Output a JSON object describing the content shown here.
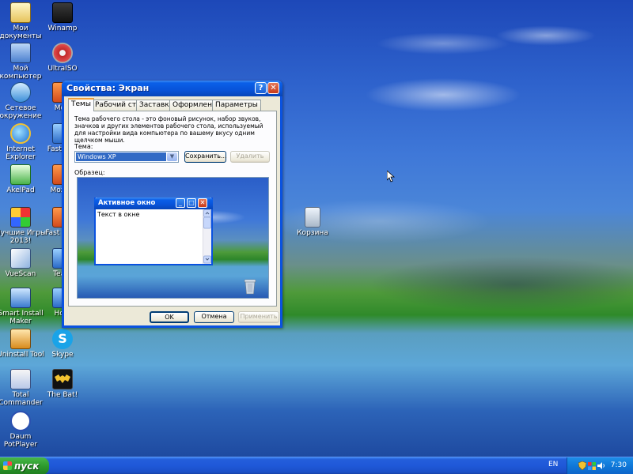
{
  "desktop": {
    "icons_col1": [
      {
        "name": "my-documents",
        "label": "Мои документы",
        "icon": "folder-docs"
      },
      {
        "name": "my-computer",
        "label": "Мой компьютер",
        "icon": "computer"
      },
      {
        "name": "network",
        "label": "Сетевое окружение",
        "icon": "network"
      },
      {
        "name": "internet-explorer",
        "label": "Internet Explorer",
        "icon": "ie"
      },
      {
        "name": "akelpad",
        "label": "AkelPad",
        "icon": "notepad"
      },
      {
        "name": "best-games",
        "label": "Лучшие Игры 2013!",
        "icon": "games"
      },
      {
        "name": "vuescan",
        "label": "VueScan",
        "icon": "scanner"
      },
      {
        "name": "smart-install-maker",
        "label": "Smart Install Maker",
        "icon": "installer"
      },
      {
        "name": "uninstall-tool",
        "label": "Uninstall Tool",
        "icon": "uninstaller"
      },
      {
        "name": "total-commander",
        "label": "Total Commander",
        "icon": "floppy"
      },
      {
        "name": "daum-potplayer",
        "label": "Daum PotPlayer",
        "icon": "player"
      }
    ],
    "icons_col2": [
      {
        "name": "winamp",
        "label": "Winamp",
        "icon": "winamp"
      },
      {
        "name": "ultraiso",
        "label": "UltraISO",
        "icon": "disc"
      },
      {
        "name": "mozilla-partial-1",
        "label": "Mozi",
        "icon": "browser"
      },
      {
        "name": "fast-partial",
        "label": "Fast Cap",
        "icon": "capture"
      },
      {
        "name": "mozilla-partial-2",
        "label": "Mozilla",
        "icon": "browser"
      },
      {
        "name": "faststone-partial",
        "label": "Fast Imag",
        "icon": "image"
      },
      {
        "name": "teamviewer-partial",
        "label": "Team",
        "icon": "remote"
      },
      {
        "name": "home-partial",
        "label": "Hom",
        "icon": "home"
      },
      {
        "name": "skype",
        "label": "Skype",
        "icon": "skype"
      },
      {
        "name": "the-bat",
        "label": "The Bat!",
        "icon": "bat"
      }
    ],
    "recycle_bin": {
      "label": "Корзина",
      "icon": "recycle-bin"
    }
  },
  "dialog": {
    "title": "Свойства: Экран",
    "help": "?",
    "close": "✕",
    "tabs": [
      {
        "label": "Темы",
        "active": true
      },
      {
        "label": "Рабочий стол",
        "active": false
      },
      {
        "label": "Заставка",
        "active": false
      },
      {
        "label": "Оформление",
        "active": false
      },
      {
        "label": "Параметры",
        "active": false
      }
    ],
    "description": "Тема рабочего стола - это фоновый рисунок, набор звуков, значков и других элементов рабочего стола, используемый для настройки вида компьютера по вашему вкусу одним щелчком мыши.",
    "theme_label": "Тема:",
    "theme_value": "Windows XP",
    "save_button": "Сохранить...",
    "delete_button": "Удалить",
    "sample_label": "Образец:",
    "preview": {
      "window_title": "Активное окно",
      "window_text": "Текст в окне"
    },
    "ok": "OK",
    "cancel": "Отмена",
    "apply": "Применить"
  },
  "taskbar": {
    "start": "пуск",
    "language": "EN",
    "clock": "7:30"
  },
  "colors": {
    "xp_blue": "#0a52e0",
    "start_green": "#2d9a2d",
    "dialog_bg": "#ece9d8",
    "selection": "#316ac5"
  }
}
